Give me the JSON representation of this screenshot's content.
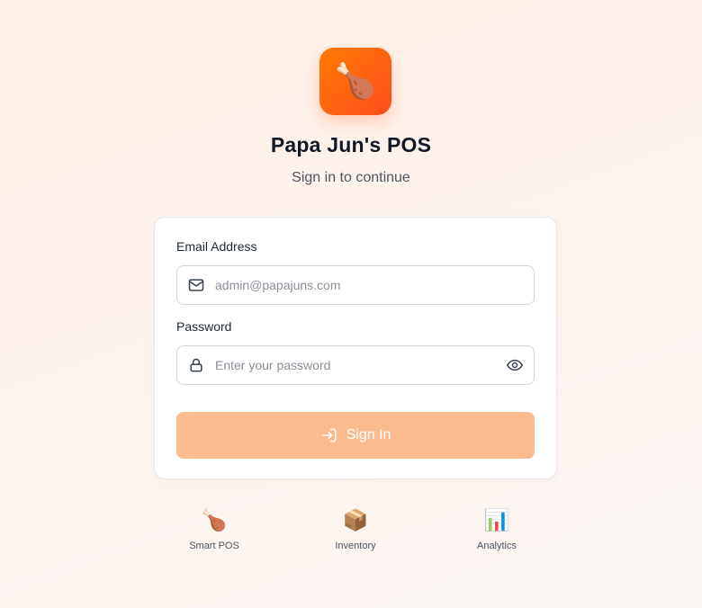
{
  "app": {
    "logo_icon": "drumstick-icon",
    "logo_glyph": "🍗",
    "title": "Papa Jun's POS",
    "subtitle": "Sign in to continue"
  },
  "form": {
    "email": {
      "label": "Email Address",
      "placeholder": "admin@papajuns.com",
      "value": "",
      "icon": "mail-icon"
    },
    "password": {
      "label": "Password",
      "placeholder": "Enter your password",
      "value": "",
      "icon": "lock-icon",
      "toggle_icon": "eye-icon"
    },
    "submit": {
      "label": "Sign In",
      "icon": "sign-in-icon"
    }
  },
  "features": [
    {
      "icon": "drumstick-icon",
      "glyph": "🍗",
      "label": "Smart POS"
    },
    {
      "icon": "package-icon",
      "glyph": "📦",
      "label": "Inventory"
    },
    {
      "icon": "bar-chart-icon",
      "glyph": "📊",
      "label": "Analytics"
    }
  ],
  "colors": {
    "brand_gradient_start": "#ff7a00",
    "brand_gradient_end": "#ff4d1f",
    "button_bg": "#fbbb8c",
    "background": "#fdf2ea"
  }
}
